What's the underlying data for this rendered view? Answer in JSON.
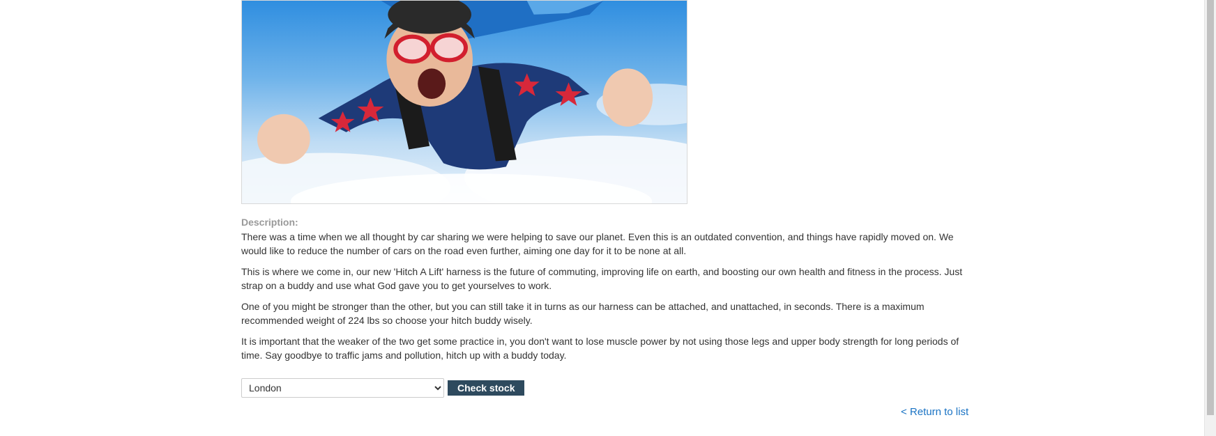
{
  "product": {
    "image_alt": "Tandem skydivers in blue jumpsuits with red stars falling through the sky",
    "description_label": "Description:",
    "description": [
      "There was a time when we all thought by car sharing we were helping to save our planet. Even this is an outdated convention, and things have rapidly moved on. We would like to reduce the number of cars on the road even further, aiming one day for it to be none at all.",
      "This is where we come in, our new 'Hitch A Lift' harness is the future of commuting, improving life on earth, and boosting our own health and fitness in the process. Just strap on a buddy and use what God gave you to get yourselves to work.",
      "One of you might be stronger than the other, but you can still take it in turns as our harness can be attached, and unattached, in seconds. There is a maximum recommended weight of 224 lbs so choose your hitch buddy wisely.",
      "It is important that the weaker of the two get some practice in, you don't want to lose muscle power by not using those legs and upper body strength for long periods of time. Say goodbye to traffic jams and pollution, hitch up with a buddy today."
    ]
  },
  "stock_check": {
    "selected_store": "London",
    "button_label": "Check stock"
  },
  "navigation": {
    "return_link": "< Return to list"
  },
  "colors": {
    "button_bg": "#2e4a5e",
    "link": "#1a73c4",
    "label": "#999999",
    "text": "#333333"
  }
}
